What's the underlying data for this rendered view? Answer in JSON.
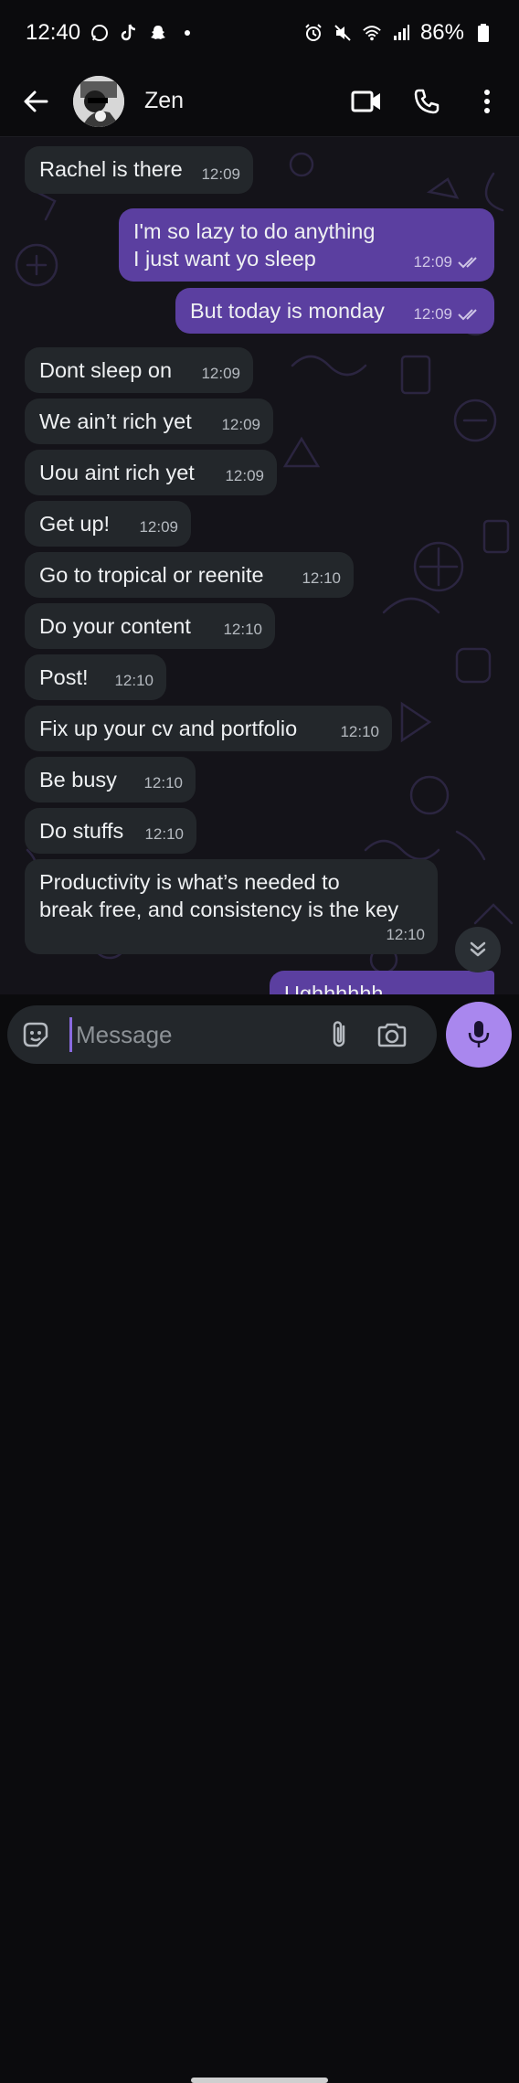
{
  "status_bar": {
    "time": "12:40",
    "battery": "86%",
    "left_icons": [
      "whatsapp-icon",
      "tiktok-icon",
      "snapchat-icon",
      "dot-icon"
    ],
    "right_icons": [
      "alarm-icon",
      "mute-icon",
      "wifi-icon",
      "signal-icon",
      "battery-icon"
    ]
  },
  "header": {
    "contact_name": "Zen",
    "actions": [
      "video-call",
      "voice-call",
      "more-options"
    ]
  },
  "messages": [
    {
      "dir": "in",
      "text": "Rachel is there",
      "time": "12:09"
    },
    {
      "dir": "out",
      "text": "I'm so lazy to do anything\nI just want yo sleep",
      "time": "12:09",
      "status": "read"
    },
    {
      "dir": "out",
      "text": "But today is monday",
      "time": "12:09",
      "status": "read"
    },
    {
      "dir": "in",
      "text": "Dont sleep on",
      "time": "12:09"
    },
    {
      "dir": "in",
      "text": "We ain’t rich yet",
      "time": "12:09"
    },
    {
      "dir": "in",
      "text": "Uou aint rich yet",
      "time": "12:09"
    },
    {
      "dir": "in",
      "text": "Get  up!",
      "time": "12:09"
    },
    {
      "dir": "in",
      "text": "Go to tropical or reenite",
      "time": "12:10"
    },
    {
      "dir": "in",
      "text": "Do your content",
      "time": "12:10"
    },
    {
      "dir": "in",
      "text": "Post!",
      "time": "12:10"
    },
    {
      "dir": "in",
      "text": "Fix up your cv and portfolio",
      "time": "12:10"
    },
    {
      "dir": "in",
      "text": "Be busy",
      "time": "12:10"
    },
    {
      "dir": "in",
      "text": "Do stuffs",
      "time": "12:10"
    },
    {
      "dir": "in",
      "text": "Productivity is what’s needed to\nbreak free, and consistency is the key",
      "time": "12:10"
    },
    {
      "dir": "out",
      "text": "Ughhhhhh",
      "time": "",
      "status": "read"
    }
  ],
  "composer": {
    "placeholder": "Message",
    "value": ""
  },
  "colors": {
    "outgoing_bubble": "#5b3fa0",
    "incoming_bubble": "#23272b",
    "mic_button": "#a987ee",
    "chat_background": "#141319"
  }
}
